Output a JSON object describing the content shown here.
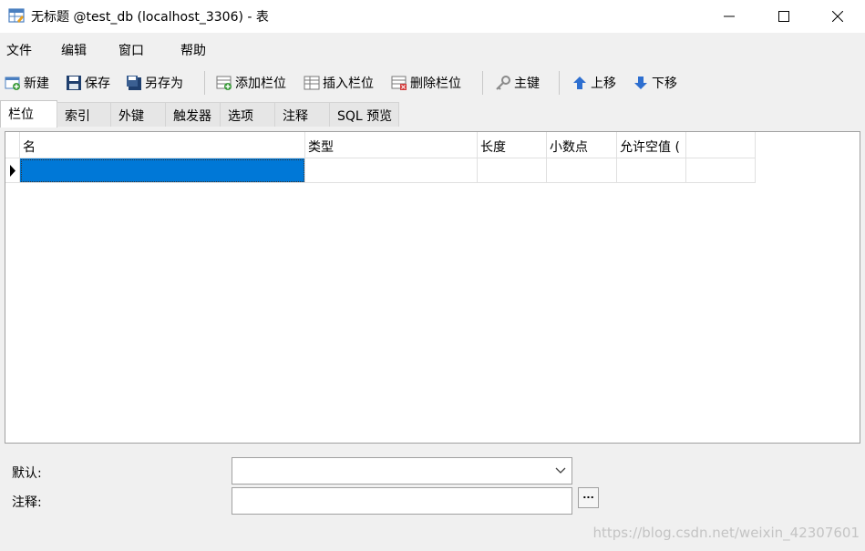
{
  "window": {
    "title": "无标题 @test_db (localhost_3306) - 表",
    "controls": {
      "minimize": "—",
      "maximize": "☐",
      "close": "✕"
    }
  },
  "menu": [
    {
      "label": "文件"
    },
    {
      "label": "编辑"
    },
    {
      "label": "窗口"
    },
    {
      "label": "帮助"
    }
  ],
  "toolbar": {
    "new": "新建",
    "save": "保存",
    "save_as": "另存为",
    "add_field": "添加栏位",
    "insert_field": "插入栏位",
    "delete_field": "删除栏位",
    "primary_key": "主键",
    "move_up": "上移",
    "move_down": "下移"
  },
  "tabs": [
    {
      "label": "栏位",
      "active": true
    },
    {
      "label": "索引"
    },
    {
      "label": "外键"
    },
    {
      "label": "触发器"
    },
    {
      "label": "选项"
    },
    {
      "label": "注释"
    },
    {
      "label": "SQL 预览"
    }
  ],
  "grid": {
    "columns": [
      "名",
      "类型",
      "长度",
      "小数点",
      "允许空值 ("
    ],
    "rows": [
      {
        "name": "",
        "type": "",
        "length": "",
        "decimals": "",
        "nullable": ""
      }
    ]
  },
  "form": {
    "default_label": "默认:",
    "default_value": "",
    "comment_label": "注释:",
    "comment_value": "",
    "ellipsis": "..."
  },
  "watermark": "https://blog.csdn.net/weixin_42307601",
  "colors": {
    "selection": "#0078d7",
    "save_icon": "#1f3f6e",
    "arrow_icon": "#2e6fd0"
  }
}
